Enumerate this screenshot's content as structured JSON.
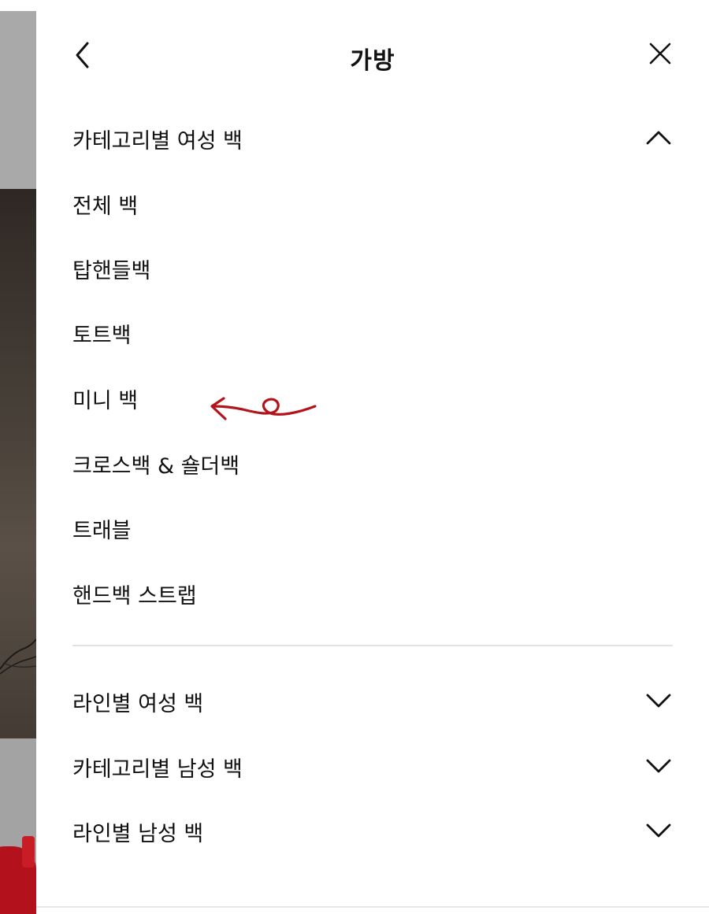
{
  "header": {
    "title": "가방",
    "back_icon": "chevron-left-icon",
    "close_icon": "close-icon"
  },
  "sections": [
    {
      "label": "카테고리별 여성 백",
      "expanded": true,
      "chevron_icon": "chevron-up-icon",
      "items": [
        "전체 백",
        "탑핸들백",
        "토트백",
        "미니 백",
        "크로스백 & 숄더백",
        "트래블",
        "핸드백 스트랩"
      ]
    },
    {
      "label": "라인별 여성 백",
      "expanded": false,
      "chevron_icon": "chevron-down-icon"
    },
    {
      "label": "카테고리별 남성 백",
      "expanded": false,
      "chevron_icon": "chevron-down-icon"
    },
    {
      "label": "라인별 남성 백",
      "expanded": false,
      "chevron_icon": "chevron-down-icon"
    }
  ],
  "annotation": {
    "target": "미니 백",
    "color": "#b3141c"
  }
}
